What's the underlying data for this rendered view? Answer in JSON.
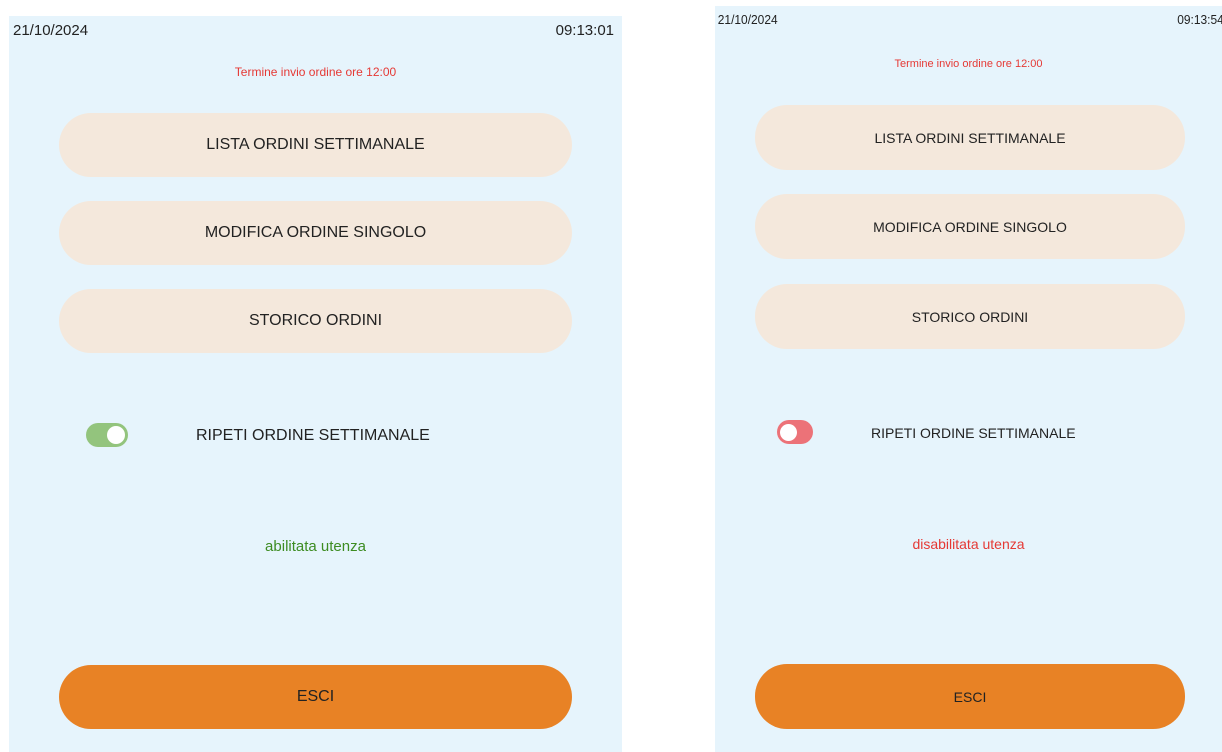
{
  "screens": [
    {
      "date": "21/10/2024",
      "time": "09:13:01",
      "deadline": "Termine invio ordine ore 12:00",
      "menu": [
        {
          "label": "LISTA ORDINI SETTIMANALE"
        },
        {
          "label": "MODIFICA ORDINE SINGOLO"
        },
        {
          "label": "STORICO ORDINI"
        }
      ],
      "repeat_toggle": {
        "label": "RIPETI ORDINE SETTIMANALE",
        "state": "on",
        "color": "#93c47d"
      },
      "status_text": "abilitata utenza",
      "status_color": "#3d8c22",
      "exit_label": "ESCI"
    },
    {
      "date": "21/10/2024",
      "time": "09:13:54",
      "deadline": "Termine invio ordine ore 12:00",
      "menu": [
        {
          "label": "LISTA ORDINI SETTIMANALE"
        },
        {
          "label": "MODIFICA ORDINE SINGOLO"
        },
        {
          "label": "STORICO ORDINI"
        }
      ],
      "repeat_toggle": {
        "label": "RIPETI ORDINE SETTIMANALE",
        "state": "off",
        "color": "#ec7278"
      },
      "status_text": "disabilitata utenza",
      "status_color": "#e53935",
      "exit_label": "ESCI"
    }
  ],
  "colors": {
    "screen_bg": "#e6f4fc",
    "menu_button_bg": "#f4e8dc",
    "exit_button_bg": "#e88225",
    "deadline_text": "#e53935"
  }
}
